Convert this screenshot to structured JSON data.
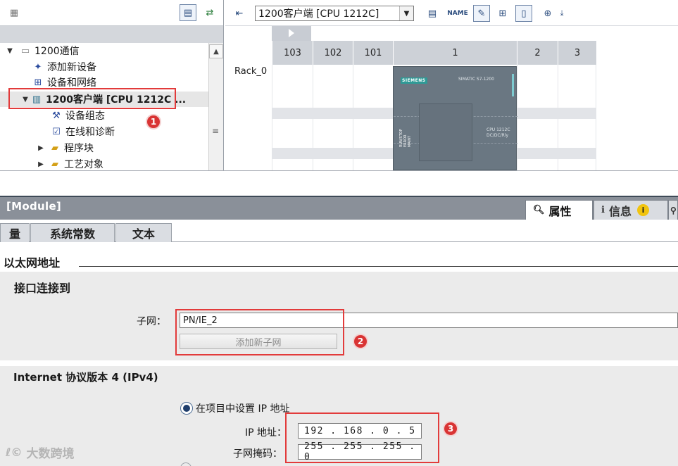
{
  "project_tree": {
    "items": [
      {
        "label": "1200通信",
        "icon": "project-icon",
        "toggle": "▼"
      },
      {
        "label": "添加新设备",
        "icon": "add-device-icon",
        "toggle": ""
      },
      {
        "label": "设备和网络",
        "icon": "network-icon",
        "toggle": ""
      },
      {
        "label": "1200客户端 [CPU 1212C ...",
        "icon": "plc-icon",
        "toggle": "▼"
      },
      {
        "label": "设备组态",
        "icon": "device-config-icon",
        "toggle": ""
      },
      {
        "label": "在线和诊断",
        "icon": "online-diagnostics-icon",
        "toggle": ""
      },
      {
        "label": "程序块",
        "icon": "folder-icon",
        "toggle": "▶"
      },
      {
        "label": "工艺对象",
        "icon": "folder-icon",
        "toggle": "▶"
      }
    ]
  },
  "device_view": {
    "selected_device": "1200客户端 [CPU 1212C]",
    "rack_label": "Rack_0",
    "slots": [
      "103",
      "102",
      "101",
      "1",
      "2",
      "3"
    ],
    "cpu": {
      "brand": "SIEMENS",
      "model": "SIMATIC S7-1200",
      "name_line1": "CPU 1212C",
      "name_line2": "DC/DC/Rly",
      "led_text": "RUN/STOP ERROR MAINT"
    }
  },
  "inspector": {
    "title": "[Module]",
    "tabs": [
      {
        "label": "属性",
        "icon": "magnifier-icon"
      },
      {
        "label": "信息",
        "icon": "info-icon",
        "badge": "i"
      }
    ],
    "subtabs": [
      "量",
      "系统常数",
      "文本"
    ],
    "section_ethernet": "以太网地址",
    "section_interface": "接口连接到",
    "subnet_label": "子网：",
    "subnet_value": "PN/IE_2",
    "add_subnet_button": "添加新子网",
    "section_ipv4": "Internet 协议版本 4 (IPv4)",
    "radio_set_ip": "在项目中设置 IP 地址",
    "ip_label": "IP 地址：",
    "ip_value": "192 . 168 . 0   . 5",
    "mask_label": "子网掩码：",
    "mask_value": "255 . 255 . 255 . 0"
  },
  "annotations": {
    "badge1": "1",
    "badge2": "2",
    "badge3": "3",
    "color": "#e23b3b"
  },
  "watermark": {
    "logo": "ℓ©",
    "text": "大数跨境"
  },
  "colors": {
    "inspector_header": "#8a9099",
    "slot_header": "#cdd1d7",
    "cpu_body": "#6a7782"
  }
}
